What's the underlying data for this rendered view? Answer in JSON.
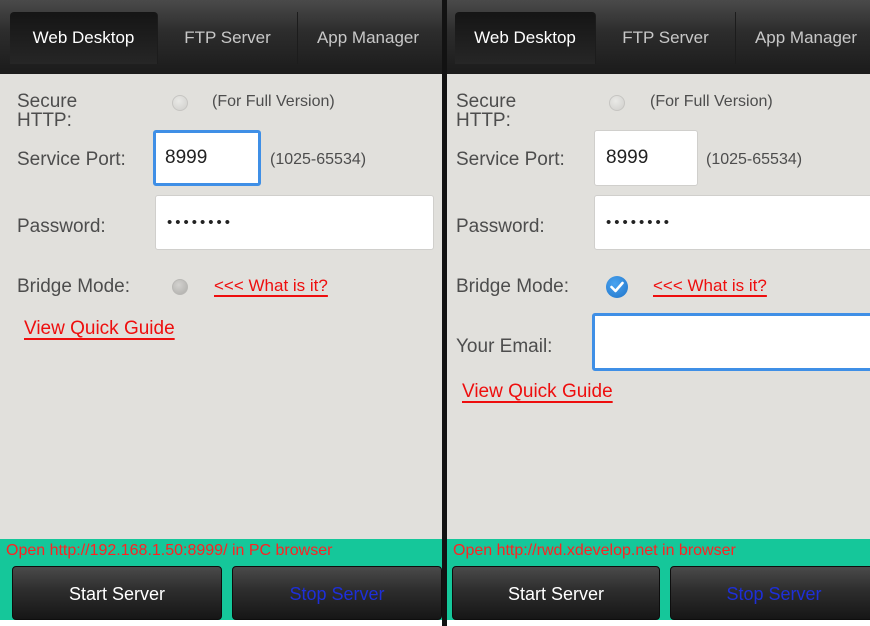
{
  "colors": {
    "accent_bar": "#15c79a",
    "status_text": "#ff2222",
    "link_red": "#ee0e0e",
    "stop_text": "#1e2fd8",
    "focus_blue": "#3f8fe6"
  },
  "left": {
    "tabs": [
      "Web Desktop",
      "FTP Server",
      "App Manager"
    ],
    "active_tab": "Web Desktop",
    "secure_http_label": "Secure HTTP:",
    "secure_http_hint": "(For Full Version)",
    "service_port_label": "Service Port:",
    "service_port_value": "8999",
    "port_range_hint": "(1025-65534)",
    "password_label": "Password:",
    "password_value": "12345678",
    "bridge_mode_label": "Bridge Mode:",
    "bridge_mode_checked": false,
    "what_is_it_link": "<<< What is it?",
    "quick_guide_link": "View Quick Guide",
    "status_text": "Open http://192.168.1.50:8999/ in PC browser",
    "start_button": "Start Server",
    "stop_button": "Stop Server"
  },
  "right": {
    "tabs": [
      "Web Desktop",
      "FTP Server",
      "App Manager"
    ],
    "active_tab": "Web Desktop",
    "secure_http_label": "Secure HTTP:",
    "secure_http_hint": "(For Full Version)",
    "service_port_label": "Service Port:",
    "service_port_value": "8999",
    "port_range_hint": "(1025-65534)",
    "password_label": "Password:",
    "password_value": "12345678",
    "bridge_mode_label": "Bridge Mode:",
    "bridge_mode_checked": true,
    "what_is_it_link": "<<< What is it?",
    "email_label": "Your Email:",
    "email_value": "",
    "quick_guide_link": "View Quick Guide",
    "status_text": "Open http://rwd.xdevelop.net in browser",
    "start_button": "Start Server",
    "stop_button": "Stop Server"
  }
}
